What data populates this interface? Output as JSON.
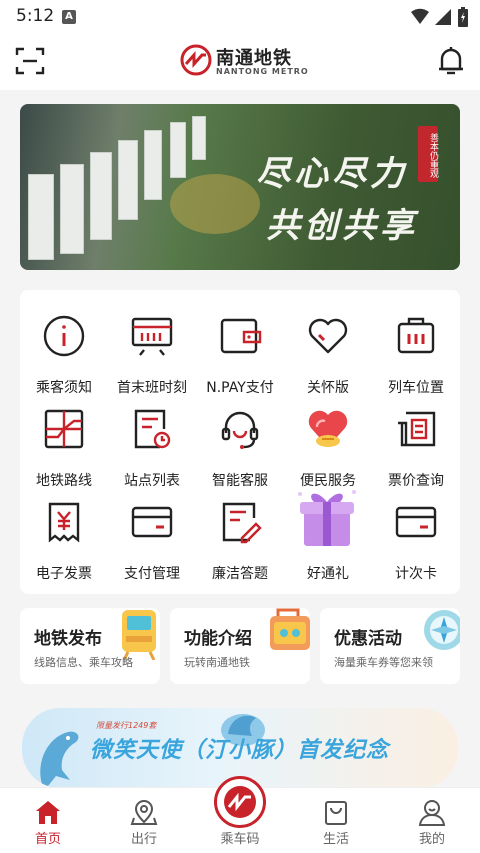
{
  "status_bar": {
    "time": "5:12",
    "indicator": "A"
  },
  "header": {
    "logo_cn": "南通地铁",
    "logo_en": "NANTONG METRO",
    "scan_icon": "scan-icon",
    "bell_icon": "bell-icon"
  },
  "banner": {
    "line1": "尽心尽力",
    "line2": "共创共享",
    "seal": "善本仍重观"
  },
  "services": [
    {
      "label": "乘客须知",
      "icon": "info-icon"
    },
    {
      "label": "首末班时刻",
      "icon": "timetable-icon"
    },
    {
      "label": "N.PAY支付",
      "icon": "wallet-icon"
    },
    {
      "label": "关怀版",
      "icon": "heart-icon"
    },
    {
      "label": "列车位置",
      "icon": "train-position-icon"
    },
    {
      "label": "地铁路线",
      "icon": "route-map-icon"
    },
    {
      "label": "站点列表",
      "icon": "station-list-icon"
    },
    {
      "label": "智能客服",
      "icon": "headset-icon"
    },
    {
      "label": "便民服务",
      "icon": "service-heart-icon"
    },
    {
      "label": "票价查询",
      "icon": "fare-query-icon"
    },
    {
      "label": "电子发票",
      "icon": "invoice-icon"
    },
    {
      "label": "支付管理",
      "icon": "card-icon"
    },
    {
      "label": "廉洁答题",
      "icon": "quiz-icon"
    },
    {
      "label": "好通礼",
      "icon": "gift-icon"
    },
    {
      "label": "计次卡",
      "icon": "count-card-icon"
    }
  ],
  "features": [
    {
      "title": "地铁发布",
      "subtitle": "线路信息、乘车攻略",
      "icon": "train-illustration-icon"
    },
    {
      "title": "功能介绍",
      "subtitle": "玩转南通地铁",
      "icon": "toolbox-illustration-icon"
    },
    {
      "title": "优惠活动",
      "subtitle": "海量乘车券等您来领",
      "icon": "compass-illustration-icon"
    }
  ],
  "promo": {
    "small_text": "限量发行1249套",
    "title": "微笑天使（汀小豚）首发纪念"
  },
  "tabbar": [
    {
      "label": "首页",
      "icon": "home-icon",
      "active": true
    },
    {
      "label": "出行",
      "icon": "location-icon",
      "active": false
    },
    {
      "label": "乘车码",
      "icon": "ride-code-icon",
      "active": false
    },
    {
      "label": "生活",
      "icon": "shopping-bag-icon",
      "active": false
    },
    {
      "label": "我的",
      "icon": "profile-icon",
      "active": false
    }
  ],
  "colors": {
    "brand_red": "#c8222a",
    "dark": "#222222"
  }
}
